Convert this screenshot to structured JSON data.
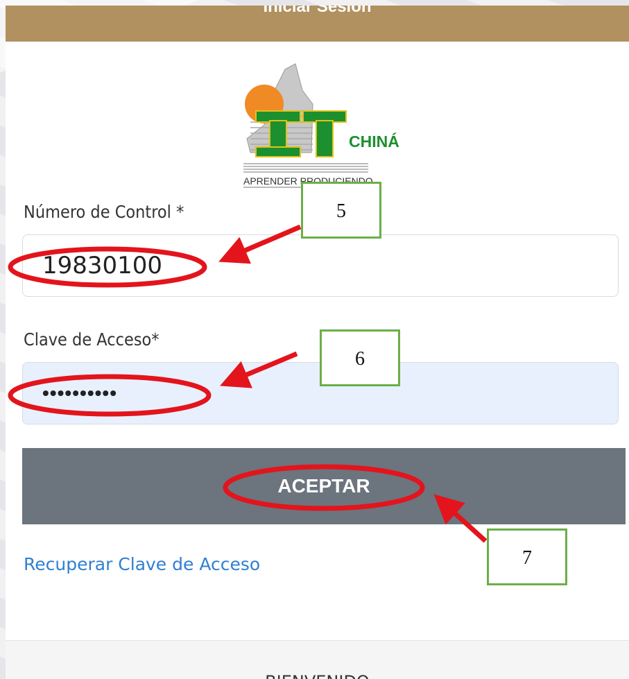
{
  "header": {
    "title": "Iniciar Sesion"
  },
  "logo": {
    "big_text": "IT",
    "name": "CHINÁ",
    "motto": "APRENDER PRODUCIENDO"
  },
  "form": {
    "control_label": "Número de Control *",
    "control_value": "19830100",
    "password_label": "Clave de Acceso*",
    "password_value": "••••••••••",
    "submit_label": "ACEPTAR",
    "recover_link": "Recuperar Clave de Acceso"
  },
  "footer": {
    "text": "BIENVENIDO"
  },
  "annotations": [
    {
      "number": "5"
    },
    {
      "number": "6"
    },
    {
      "number": "7"
    }
  ],
  "colors": {
    "header": "#b0915f",
    "button": "#6c747d",
    "link": "#2f7fd3",
    "annotation_circle": "#e3141c",
    "annotation_box": "#6aaf46"
  }
}
